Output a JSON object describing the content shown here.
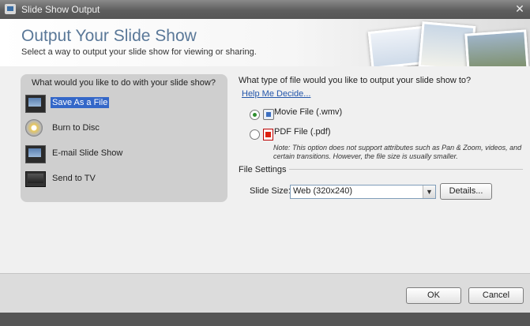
{
  "window": {
    "title": "Slide Show Output",
    "close_glyph": "✕"
  },
  "header": {
    "title": "Output Your Slide Show",
    "subtitle": "Select a way to output your slide show for viewing or sharing."
  },
  "left_panel": {
    "question": "What would you like to do with your slide show?",
    "options": [
      {
        "label": "Save As a File",
        "icon": "film-icon",
        "selected": true
      },
      {
        "label": "Burn to Disc",
        "icon": "disc-icon",
        "selected": false
      },
      {
        "label": "E-mail Slide Show",
        "icon": "email-film-icon",
        "selected": false
      },
      {
        "label": "Send to TV",
        "icon": "tv-icon",
        "selected": false
      }
    ]
  },
  "right_panel": {
    "question": "What type of file would you like to output your slide show to?",
    "help_link": "Help Me Decide...",
    "movie_option": {
      "label": "Movie File (.wmv)",
      "checked": true
    },
    "pdf_option": {
      "label": "PDF File (.pdf)",
      "checked": false
    },
    "note": "Note: This option does not support attributes such as Pan & Zoom, videos, and certain transitions. However, the file size is usually smaller.",
    "file_settings_label": "File Settings",
    "slide_size_label": "Slide Size:",
    "slide_size_value": "Web (320x240)",
    "details_button": "Details..."
  },
  "footer": {
    "ok_label": "OK",
    "cancel_label": "Cancel"
  },
  "colors": {
    "title_blue": "#5a7898",
    "selection_blue": "#3467c8",
    "link_blue": "#2255aa"
  }
}
